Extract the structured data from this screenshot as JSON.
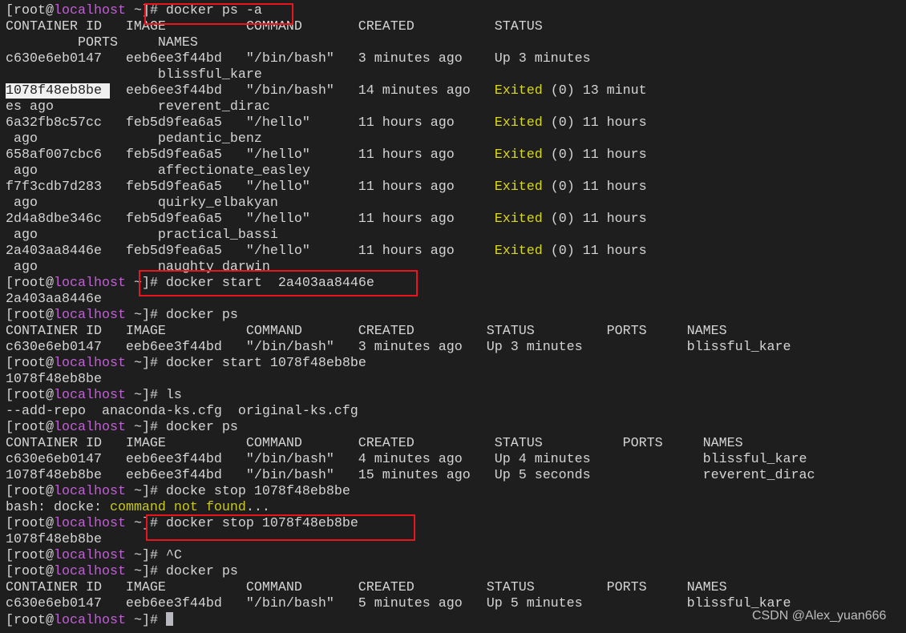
{
  "terminal": {
    "lines": [
      [
        {
          "t": "[root@"
        },
        {
          "t": "localhost",
          "c": "host"
        },
        {
          "t": " ~]# docker ps -a"
        }
      ],
      [
        {
          "t": "CONTAINER ID   IMAGE          COMMAND       CREATED          STATUS"
        }
      ],
      [
        {
          "t": "         PORTS     NAMES"
        }
      ],
      [
        {
          "t": "c630e6eb0147   eeb6ee3f44bd   \"/bin/bash\"   3 minutes ago    Up 3 minutes"
        }
      ],
      [
        {
          "t": "                   blissful_kare"
        }
      ],
      [
        {
          "t": "1078f48eb8be ",
          "c": "sel"
        },
        {
          "t": "  eeb6ee3f44bd   \"/bin/bash\"   14 minutes ago   "
        },
        {
          "t": "Exited",
          "c": "exited"
        },
        {
          "t": " (0) 13 minut"
        }
      ],
      [
        {
          "t": "es ago             reverent_dirac"
        }
      ],
      [
        {
          "t": "6a32fb8c57cc   feb5d9fea6a5   \"/hello\"      11 hours ago     "
        },
        {
          "t": "Exited",
          "c": "exited"
        },
        {
          "t": " (0) 11 hours"
        }
      ],
      [
        {
          "t": " ago               pedantic_benz"
        }
      ],
      [
        {
          "t": "658af007cbc6   feb5d9fea6a5   \"/hello\"      11 hours ago     "
        },
        {
          "t": "Exited",
          "c": "exited"
        },
        {
          "t": " (0) 11 hours"
        }
      ],
      [
        {
          "t": " ago               affectionate_easley"
        }
      ],
      [
        {
          "t": "f7f3cdb7d283   feb5d9fea6a5   \"/hello\"      11 hours ago     "
        },
        {
          "t": "Exited",
          "c": "exited"
        },
        {
          "t": " (0) 11 hours"
        }
      ],
      [
        {
          "t": " ago               quirky_elbakyan"
        }
      ],
      [
        {
          "t": "2d4a8dbe346c   feb5d9fea6a5   \"/hello\"      11 hours ago     "
        },
        {
          "t": "Exited",
          "c": "exited"
        },
        {
          "t": " (0) 11 hours"
        }
      ],
      [
        {
          "t": " ago               practical_bassi"
        }
      ],
      [
        {
          "t": "2a403aa8446e   feb5d9fea6a5   \"/hello\"      11 hours ago     "
        },
        {
          "t": "Exited",
          "c": "exited"
        },
        {
          "t": " (0) 11 hours"
        }
      ],
      [
        {
          "t": " ago               naughty_darwin"
        }
      ],
      [
        {
          "t": "[root@"
        },
        {
          "t": "localhost",
          "c": "host"
        },
        {
          "t": " ~]# docker start  2a403aa8446e"
        }
      ],
      [
        {
          "t": "2a403aa8446e"
        }
      ],
      [
        {
          "t": "[root@"
        },
        {
          "t": "localhost",
          "c": "host"
        },
        {
          "t": " ~]# docker ps"
        }
      ],
      [
        {
          "t": "CONTAINER ID   IMAGE          COMMAND       CREATED         STATUS         PORTS     NAMES"
        }
      ],
      [
        {
          "t": "c630e6eb0147   eeb6ee3f44bd   \"/bin/bash\"   3 minutes ago   Up 3 minutes             blissful_kare"
        }
      ],
      [
        {
          "t": "[root@"
        },
        {
          "t": "localhost",
          "c": "host"
        },
        {
          "t": " ~]# docker start 1078f48eb8be"
        }
      ],
      [
        {
          "t": "1078f48eb8be"
        }
      ],
      [
        {
          "t": "[root@"
        },
        {
          "t": "localhost",
          "c": "host"
        },
        {
          "t": " ~]# ls"
        }
      ],
      [
        {
          "t": "--add-repo  anaconda-ks.cfg  original-ks.cfg"
        }
      ],
      [
        {
          "t": "[root@"
        },
        {
          "t": "localhost",
          "c": "host"
        },
        {
          "t": " ~]# docker ps"
        }
      ],
      [
        {
          "t": "CONTAINER ID   IMAGE          COMMAND       CREATED          STATUS          PORTS     NAMES"
        }
      ],
      [
        {
          "t": "c630e6eb0147   eeb6ee3f44bd   \"/bin/bash\"   4 minutes ago    Up 4 minutes              blissful_kare"
        }
      ],
      [
        {
          "t": "1078f48eb8be   eeb6ee3f44bd   \"/bin/bash\"   15 minutes ago   Up 5 seconds              reverent_dirac"
        }
      ],
      [
        {
          "t": "[root@"
        },
        {
          "t": "localhost",
          "c": "host"
        },
        {
          "t": " ~]# docke stop 1078f48eb8be"
        }
      ],
      [
        {
          "t": "bash: docke: "
        },
        {
          "t": "command not found",
          "c": "warn"
        },
        {
          "t": "..."
        }
      ],
      [
        {
          "t": "[root@"
        },
        {
          "t": "localhost",
          "c": "host"
        },
        {
          "t": " ~]# docker stop 1078f48eb8be"
        }
      ],
      [
        {
          "t": "1078f48eb8be"
        }
      ],
      [
        {
          "t": "[root@"
        },
        {
          "t": "localhost",
          "c": "host"
        },
        {
          "t": " ~]# ^C"
        }
      ],
      [
        {
          "t": "[root@"
        },
        {
          "t": "localhost",
          "c": "host"
        },
        {
          "t": " ~]# docker ps"
        }
      ],
      [
        {
          "t": "CONTAINER ID   IMAGE          COMMAND       CREATED         STATUS         PORTS     NAMES"
        }
      ],
      [
        {
          "t": "c630e6eb0147   eeb6ee3f44bd   \"/bin/bash\"   5 minutes ago   Up 5 minutes             blissful_kare"
        }
      ],
      [
        {
          "t": "[root@"
        },
        {
          "t": "localhost",
          "c": "host"
        },
        {
          "t": " ~]# "
        },
        {
          "t": "",
          "c": "cursor"
        }
      ]
    ]
  },
  "watermark": "CSDN @Alex_yuan666",
  "colors": {
    "background": "#1e1e1e",
    "text": "#d4d4d4",
    "hostname": "#c25fd6",
    "exited": "#d9d91a",
    "annotation_box": "#e8141e"
  }
}
